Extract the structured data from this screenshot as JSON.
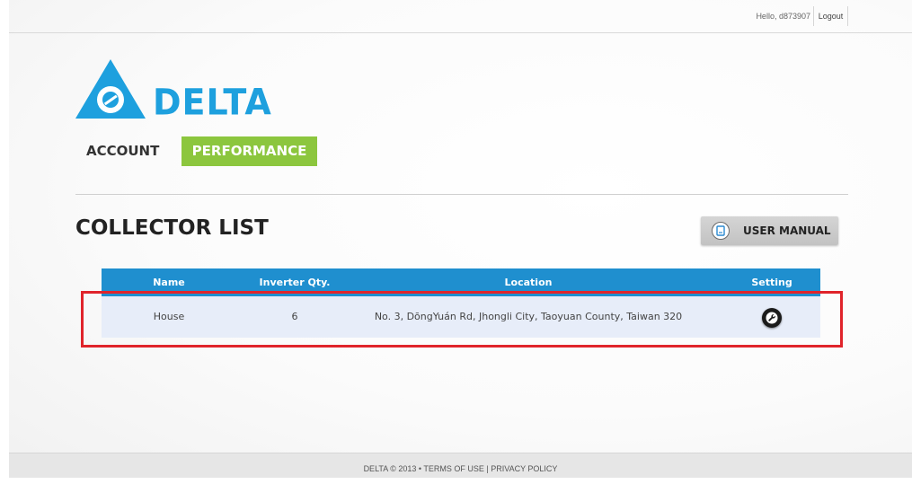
{
  "header": {
    "greeting": "Hello, d873907",
    "logout_label": "Logout"
  },
  "brand": {
    "logo_text": "DELTA",
    "color": "#1ea0de"
  },
  "nav": {
    "items": [
      {
        "label": "ACCOUNT",
        "active": false
      },
      {
        "label": "PERFORMANCE",
        "active": true
      }
    ],
    "active_color": "#8cc63e"
  },
  "page": {
    "title": "COLLECTOR LIST",
    "manual_button_label": "USER MANUAL",
    "manual_icon": "document-icon"
  },
  "table": {
    "header_color": "#1f8fcf",
    "columns": [
      "Name",
      "Inverter Qty.",
      "Location",
      "Setting"
    ],
    "rows": [
      {
        "name": "House",
        "inverter_qty": "6",
        "location": "No. 3, DōngYuán Rd, Jhongli City, Taoyuan County, Taiwan 320",
        "setting_icon": "wrench-icon"
      }
    ]
  },
  "annotation": {
    "highlight_color": "#e0242b"
  },
  "footer": {
    "text": "DELTA © 2013 • TERMS OF USE | PRIVACY POLICY"
  }
}
